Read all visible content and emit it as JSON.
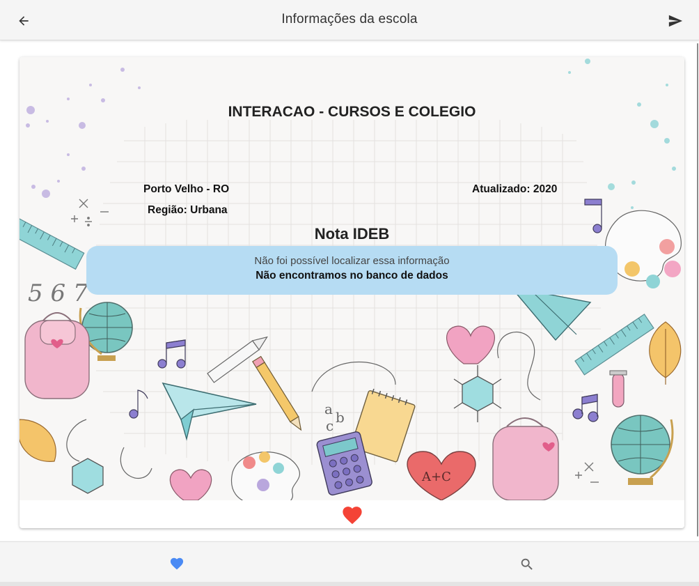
{
  "appbar": {
    "title": "Informações da escola",
    "back_icon": "arrow-back-icon",
    "send_icon": "send-icon"
  },
  "school": {
    "name": "INTERACAO - CURSOS E COLEGIO",
    "city": "Porto Velho - RO",
    "region": "Região: Urbana",
    "updated": "Atualizado: 2020"
  },
  "ideb": {
    "title": "Nota IDEB",
    "message": "Não foi possível localizar essa informação",
    "submessage": "Não encontramos no banco de dados"
  },
  "card": {
    "favorite_icon": "heart-icon",
    "favorite_color": "#f44336"
  },
  "bottomnav": {
    "favorites_icon": "heart-icon",
    "favorites_color": "#4a8af4",
    "search_icon": "search-icon"
  }
}
